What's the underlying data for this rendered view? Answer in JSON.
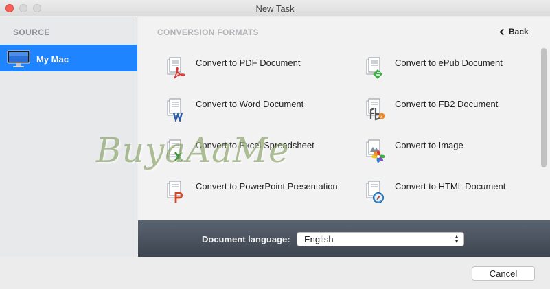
{
  "window": {
    "title": "New Task"
  },
  "sidebar": {
    "header": "SOURCE",
    "items": [
      {
        "label": "My Mac",
        "icon": "computer-icon",
        "selected": true
      }
    ]
  },
  "main": {
    "header": "CONVERSION FORMATS",
    "back_label": "Back",
    "formats": [
      {
        "label": "Convert to PDF Document",
        "icon": "pdf-document-icon"
      },
      {
        "label": "Convert to ePub Document",
        "icon": "epub-document-icon"
      },
      {
        "label": "Convert to Word Document",
        "icon": "word-document-icon"
      },
      {
        "label": "Convert to FB2 Document",
        "icon": "fb2-document-icon"
      },
      {
        "label": "Convert to Excel Spreadsheet",
        "icon": "excel-document-icon"
      },
      {
        "label": "Convert to Image",
        "icon": "image-document-icon"
      },
      {
        "label": "Convert to PowerPoint Presentation",
        "icon": "powerpoint-document-icon"
      },
      {
        "label": "Convert to HTML Document",
        "icon": "html-document-icon"
      }
    ]
  },
  "language": {
    "label": "Document language:",
    "value": "English"
  },
  "footer": {
    "cancel_label": "Cancel"
  },
  "watermark": "BuyaAaMe",
  "colors": {
    "accent": "#1e84ff",
    "close": "#fc5f57",
    "language_bar": "#4a525d"
  }
}
